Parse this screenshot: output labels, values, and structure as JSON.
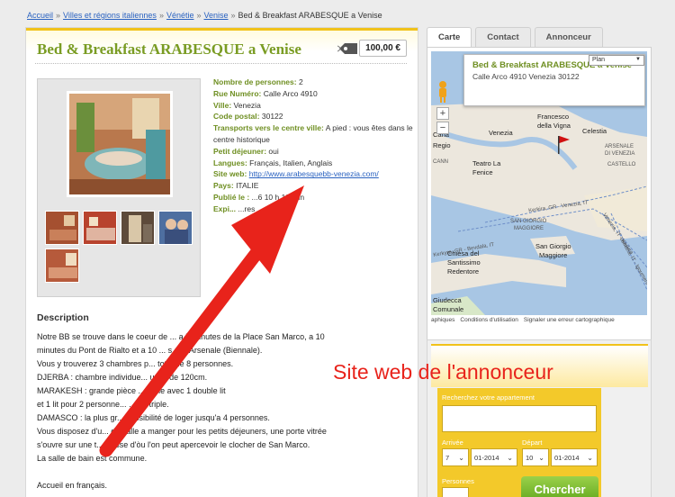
{
  "breadcrumb": {
    "items": [
      "Accueil",
      "Villes et régions italiennes",
      "Vénétie",
      "Venise"
    ],
    "current": "Bed & Breakfast ARABESQUE a Venise",
    "separator": "»"
  },
  "listing": {
    "title": "Bed & Breakfast ARABESQUE a Venise",
    "price": "100,00 €",
    "price_icon": "price-tag-icon"
  },
  "properties": [
    {
      "key": "Nombre de personnes:",
      "value": "2"
    },
    {
      "key": "Rue Numéro:",
      "value": "Calle Arco 4910"
    },
    {
      "key": "Ville:",
      "value": "Venezia"
    },
    {
      "key": "Code postal:",
      "value": "30122"
    },
    {
      "key": "Transports vers le centre ville:",
      "value": "A pied : vous êtes dans le centre historique"
    },
    {
      "key": "Petit déjeuner:",
      "value": "oui"
    },
    {
      "key": "Langues:",
      "value": "Français, Italien, Anglais"
    },
    {
      "key": "Site web:",
      "value": "http://www.arabesquebb-venezia.com/"
    },
    {
      "key": "Pays:",
      "value": "ITALIE"
    },
    {
      "key": "Publié le :",
      "value": "...6 10 h 18 min"
    },
    {
      "key": "Expi...",
      "value": "...res"
    }
  ],
  "description": {
    "heading": "Description",
    "lines": [
      "Notre BB se trouve dans le coeur de ... a 5 minutes de la Place San Marco, a 10",
      "minutes du Pont de Rialto et a 10 ... s de l'Arsenale (Biennale).",
      "Vous y trouverez 3 chambres p... total de 8 personnes.",
      "DJERBA : chambre individue... un lit de 120cm.",
      "MARAKESH : grande pièce ... table avec 1 double lit",
      "et 1 lit pour 2 personne... ... ou triple.",
      "DAMASCO : la plus gr... possibilité de loger jusqu'a 4 personnes.",
      "Vous disposez d'u... de salle a manger pour les petits déjeuners, une porte vitrée",
      "s'ouvre sur une t... rrasse d'òu l'on peut apercevoir le clocher de San Marco.",
      "La salle de bain est commune.",
      "",
      "Accueil en français."
    ]
  },
  "sidebar": {
    "tabs": [
      "Carte",
      "Contact",
      "Annonceur"
    ],
    "active_tab": "Carte",
    "map": {
      "info_title": "Bed & Breakfast ARABESQUE a Venise",
      "info_address": "Calle Arco 4910 Venezia  30122",
      "map_type": "Plan",
      "zoom_in": "+",
      "zoom_out": "−",
      "labels": {
        "francesco": "Francesco",
        "vigna": "della Vigna",
        "venezia": "Venezia",
        "celestia": "Celestia",
        "arsenale": "ARSENALE",
        "di_venezia": "DI VENEZIA",
        "castello": "CASTELLO",
        "cana": "Cana",
        "regio": "Regio",
        "cann": "CANN",
        "teatro1": "Teatro La",
        "teatro2": "Fenice",
        "kerkira": "Kerkira, GR - Venezia, IT",
        "san1": "SAN GIORGIO",
        "san2": "MAGGIORE",
        "sg1": "San Giorgio",
        "sg2": "Maggiore",
        "chiesa1": "Chiesa del",
        "chiesa2": "Santissimo",
        "chiesa3": "Redentore",
        "giudecca1": "Giudecca",
        "giudecca2": "Comunale",
        "kerk2": "Kerkyra, GR - Bevdala, IT",
        "venice_it": "Venezia, IT - Kerkira",
        "ven2": "Venezia, IT - Igoumeni"
      },
      "footer": [
        "aphiques",
        "Conditions d'utilisation",
        "Signaler une erreur cartographique"
      ]
    }
  },
  "search": {
    "label": "Recherchez votre appartement",
    "arrival_label": "Arrivée",
    "departure_label": "Départ",
    "arrival_day": "7",
    "arrival_month": "01-2014",
    "departure_day": "10",
    "departure_month": "01-2014",
    "persons_label": "Personnes",
    "button": "Chercher"
  },
  "annotation": {
    "text": "Site web de l'annonceur",
    "color": "#e8231b"
  }
}
